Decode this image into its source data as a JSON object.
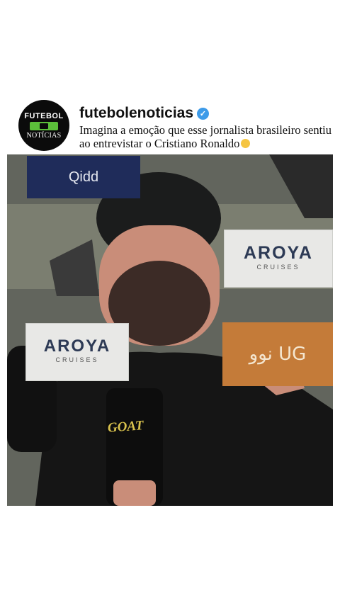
{
  "post": {
    "avatar": {
      "line1": "FUTEBOL",
      "line2": "NOTÍCIAS"
    },
    "username": "futebolenoticias",
    "verified_icon": "verified-badge-icon",
    "caption": "Imagina a emoção que esse jornalista brasileiro sentiu ao entrevistar o Cristiano Ronaldo"
  },
  "video": {
    "boards": {
      "top_left": "Qidd",
      "right": {
        "brand": "AROYA",
        "sub": "CRUISES"
      },
      "left": {
        "brand": "AROYA",
        "sub": "CRUISES"
      },
      "arabic": "نوو UG"
    },
    "mic_label": "GOAT"
  },
  "colors": {
    "verified": "#3d9be9",
    "background": "#ffffff"
  }
}
